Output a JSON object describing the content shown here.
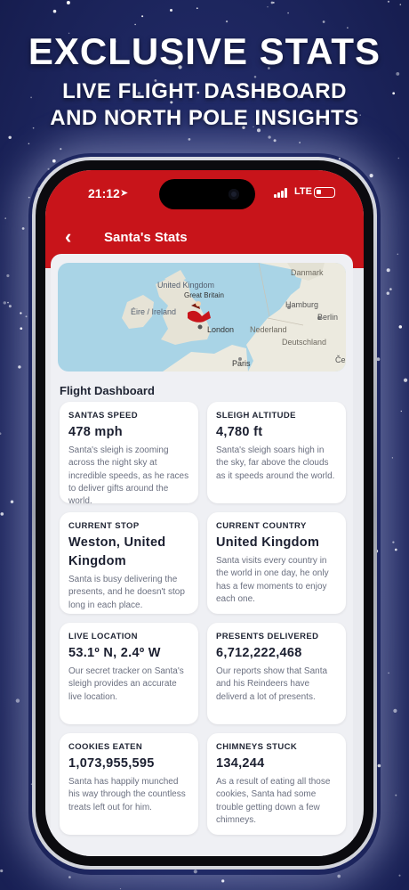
{
  "promo": {
    "headline": "EXCLUSIVE STATS",
    "subline_1": "LIVE FLIGHT DASHBOARD",
    "subline_2": "AND NORTH POLE INSIGHTS"
  },
  "status_bar": {
    "time": "21:12",
    "network": "LTE"
  },
  "nav": {
    "back_icon": "chevron-left-icon",
    "title": "Santa's Stats"
  },
  "map": {
    "labels": {
      "denmark": "Danmark",
      "united_kingdom": "United Kingdom",
      "great_britain": "Great Britain",
      "ireland": "Éire / Ireland",
      "hamburg": "Hamburg",
      "berlin": "Berlin",
      "london": "London",
      "netherlands": "Nederland",
      "germany": "Deutschland",
      "paris": "Paris",
      "ce": "Če"
    }
  },
  "section_title": "Flight Dashboard",
  "cards": [
    {
      "label": "SANTAS SPEED",
      "value": "478 mph",
      "desc": "Santa's sleigh is zooming across the night sky at incredible speeds, as he races to deliver gifts around the world."
    },
    {
      "label": "SLEIGH ALTITUDE",
      "value": "4,780 ft",
      "desc": "Santa's sleigh soars high in the sky, far above the clouds as it speeds around the world."
    },
    {
      "label": "CURRENT STOP",
      "value": "Weston, United Kingdom",
      "desc": "Santa is busy delivering the presents, and he doesn't stop long in each place."
    },
    {
      "label": "CURRENT COUNTRY",
      "value": "United Kingdom",
      "desc": "Santa visits every country in the world in one day, he only has a few moments to enjoy each one."
    },
    {
      "label": "LIVE LOCATION",
      "value": "53.1º N, 2.4º W",
      "desc": "Our secret tracker on Santa's sleigh provides an accurate live location."
    },
    {
      "label": "PRESENTS DELIVERED",
      "value": "6,712,222,468",
      "desc": "Our reports show that Santa and his Reindeers have deliverd a lot of presents."
    },
    {
      "label": "COOKIES EATEN",
      "value": "1,073,955,595",
      "desc": "Santa has happily munched his way through the countless treats left out for him."
    },
    {
      "label": "CHIMNEYS STUCK",
      "value": "134,244",
      "desc": "As a result of eating all those cookies, Santa had some trouble getting down a few chimneys."
    }
  ],
  "colors": {
    "header_red": "#c8141a",
    "background_navy": "#232d6b"
  }
}
